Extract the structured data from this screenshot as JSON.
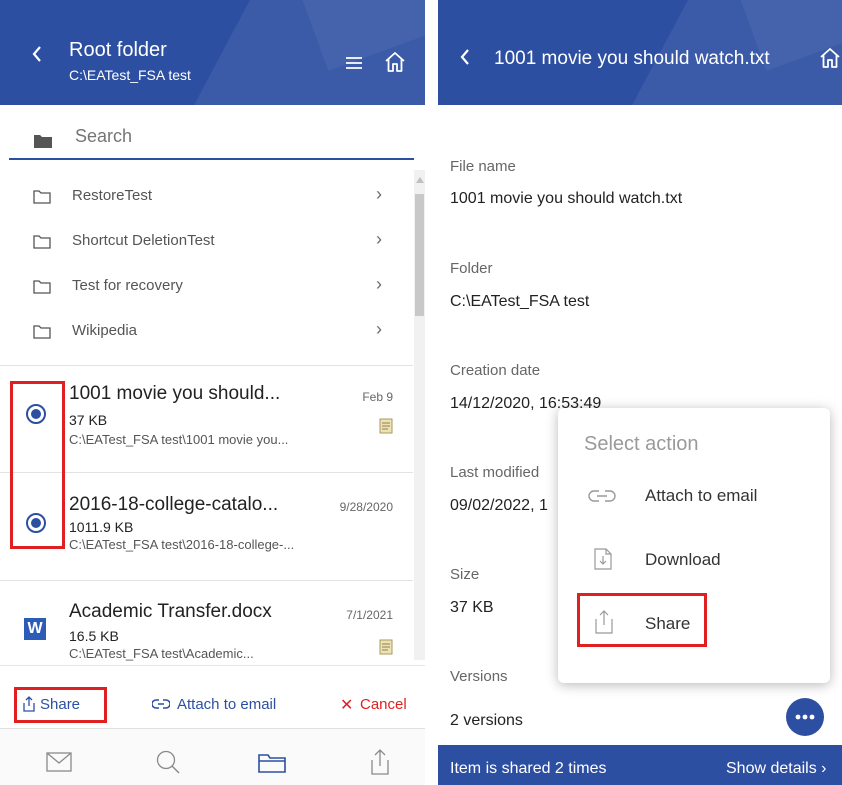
{
  "left_panel": {
    "header": {
      "title": "Root folder",
      "path": "C:\\EATest_FSA test"
    },
    "search": {
      "placeholder": "Search"
    },
    "folders": [
      {
        "name": "RestoreTest"
      },
      {
        "name": "Shortcut DeletionTest"
      },
      {
        "name": "Test for recovery"
      },
      {
        "name": "Wikipedia"
      }
    ],
    "files": [
      {
        "name": "1001 movie you should...",
        "size": "37 KB",
        "path": "C:\\EATest_FSA test\\1001 movie you...",
        "date": "Feb 9",
        "selected": true,
        "icon": "text-file-icon"
      },
      {
        "name": "2016-18-college-catalo...",
        "size": "1011.9 KB",
        "path": "C:\\EATest_FSA test\\2016-18-college-...",
        "date": "9/28/2020",
        "selected": true,
        "icon": "none"
      },
      {
        "name": "Academic Transfer.docx",
        "size": "16.5 KB",
        "path": "C:\\EATest_FSA test\\Academic...",
        "date": "7/1/2021",
        "selected": false,
        "icon": "word-icon",
        "icon_letter": "W"
      }
    ],
    "action_bar": {
      "share": "Share",
      "attach": "Attach to email",
      "cancel": "Cancel"
    },
    "bottom_nav": [
      "mail-icon",
      "search-icon",
      "folder-icon",
      "share-icon"
    ],
    "colors": {
      "header": "#2d4fa2",
      "accent": "#2d4fa2",
      "cancel": "#e02020",
      "highlight_box": "#e02020"
    }
  },
  "right_panel": {
    "header": {
      "title": "1001 movie you should watch.txt"
    },
    "details": [
      {
        "label": "File name",
        "value": "1001 movie you should watch.txt"
      },
      {
        "label": "Folder",
        "value": "C:\\EATest_FSA test"
      },
      {
        "label": "Creation date",
        "value": "14/12/2020, 16:53:49"
      },
      {
        "label": "Last modified",
        "value": "09/02/2022, 1"
      },
      {
        "label": "Size",
        "value": "37 KB"
      },
      {
        "label": "Versions",
        "value": "2 versions"
      }
    ],
    "menu": {
      "title": "Select action",
      "items": [
        {
          "label": "Attach to email",
          "icon": "link-icon"
        },
        {
          "label": "Download",
          "icon": "download-file-icon"
        },
        {
          "label": "Share",
          "icon": "share-icon"
        }
      ]
    },
    "fab": {
      "icon": "more-dots-icon"
    },
    "footer": {
      "shared_text": "Item is shared 2 times",
      "details_link": "Show details"
    }
  }
}
